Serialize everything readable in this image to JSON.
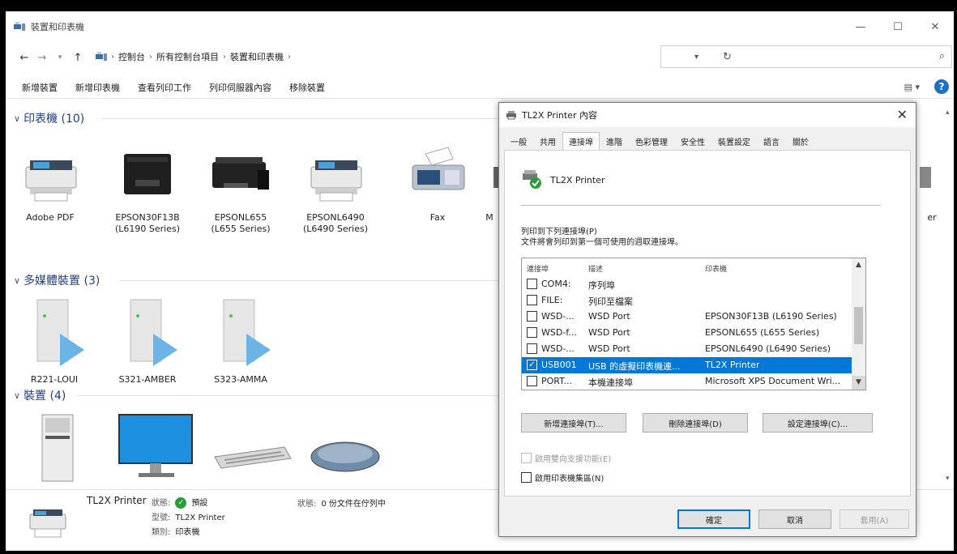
{
  "window": {
    "title": "裝置和印表機",
    "minimize": "—",
    "maximize": "☐",
    "close": "✕"
  },
  "address": {
    "crumbs": [
      "控制台",
      "所有控制台項目",
      "裝置和印表機"
    ],
    "search_placeholder": ""
  },
  "toolbar": {
    "commands": [
      "新增裝置",
      "新增印表機",
      "查看列印工作",
      "列印伺服器內容",
      "移除裝置"
    ],
    "help": "?"
  },
  "groups": {
    "printers": {
      "header": "印表機 (10)",
      "items": [
        {
          "name": "Adobe PDF",
          "sub": ""
        },
        {
          "name": "EPSON30F13B",
          "sub": "(L6190 Series)"
        },
        {
          "name": "EPSONL655",
          "sub": "(L655 Series)"
        },
        {
          "name": "EPSONL6490",
          "sub": "(L6490 Series)"
        },
        {
          "name": "Fax",
          "sub": ""
        },
        {
          "name": "M",
          "sub": ""
        },
        {
          "name": "er",
          "sub": ""
        }
      ]
    },
    "multimedia": {
      "header": "多媒體裝置 (3)",
      "items": [
        {
          "name": "R221-LOUI"
        },
        {
          "name": "S321-AMBER"
        },
        {
          "name": "S323-AMMA"
        }
      ]
    },
    "devices": {
      "header": "裝置 (4)"
    }
  },
  "statusbar": {
    "name": "TL2X Printer",
    "state_label": "狀態:",
    "state_value": "預設",
    "model_label": "型號:",
    "model_value": "TL2X Printer",
    "category_label": "類別:",
    "category_value": "印表機",
    "queue_label": "狀態:",
    "queue_value": "0 份文件在佇列中"
  },
  "dialog": {
    "title": "TL2X Printer 內容",
    "close": "✕",
    "tabs": [
      "一般",
      "共用",
      "連接埠",
      "進階",
      "色彩管理",
      "安全性",
      "裝置設定",
      "語言",
      "關於"
    ],
    "active_tab": "連接埠",
    "printer_name": "TL2X Printer",
    "desc_line1": "列印到下列連接埠(P)",
    "desc_line2": "文件將會列印到第一個可使用的週取連接埠。",
    "columns": [
      "連接埠",
      "描述",
      "印表機"
    ],
    "ports": [
      {
        "port": "COM4:",
        "desc": "序列埠",
        "printer": "",
        "checked": false
      },
      {
        "port": "FILE:",
        "desc": "列印至檔案",
        "printer": "",
        "checked": false
      },
      {
        "port": "WSD-...",
        "desc": "WSD Port",
        "printer": "EPSON30F13B (L6190 Series)",
        "checked": false
      },
      {
        "port": "WSD-f...",
        "desc": "WSD Port",
        "printer": "EPSONL655 (L655 Series)",
        "checked": false
      },
      {
        "port": "WSD-...",
        "desc": "WSD Port",
        "printer": "EPSONL6490 (L6490 Series)",
        "checked": false
      },
      {
        "port": "USB001",
        "desc": "USB 的虛擬印表機連...",
        "printer": "TL2X Printer",
        "checked": true,
        "selected": true
      },
      {
        "port": "PORT...",
        "desc": "本機連接埠",
        "printer": "Microsoft XPS Document Wri...",
        "checked": false
      }
    ],
    "btn_add": "新增連接埠(T)...",
    "btn_delete": "刪除連接埠(D)",
    "btn_config": "設定連接埠(C)...",
    "chk_bidi": "啟用雙向支援功能(E)",
    "chk_pool": "啟用印表機集區(N)",
    "ok": "確定",
    "cancel": "取消",
    "apply": "套用(A)"
  }
}
